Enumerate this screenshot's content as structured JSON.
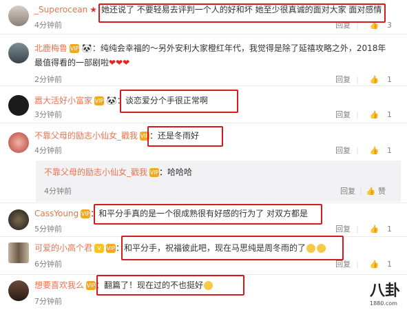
{
  "comments": [
    {
      "user": "_Superocean",
      "badge": "★",
      "text": "她还说了 不要轻易去评判一个人的好和坏 她至少很真诚的面对大家 面对感情",
      "time": "4分钟前",
      "reply": "回复",
      "likes": "3"
    },
    {
      "user": "北鹿梅鲁",
      "badge": "VIP",
      "text": "纯纯会幸福的～另外安利大家橙红年代，我觉得是除了延禧攻略之外，2018年最值得看的一部剧啦",
      "time": "2分钟前",
      "reply": "回复",
      "likes": "1"
    },
    {
      "user": "嚣大活好小富家",
      "badge": "VIP",
      "text": "谈恋爱分个手很正常啊",
      "time": "3分钟前",
      "reply": "回复",
      "likes": "1"
    },
    {
      "user": "不靠父母的励志小仙女_戳我",
      "badge": "VIP",
      "text": "还是冬雨好",
      "time": "4分钟前",
      "reply": "回复",
      "likes": "1"
    },
    {
      "user": "CassYoung",
      "badge": "VIP",
      "text": "和平分手真的是一个很成熟很有好感的行为了 对双方都是",
      "time": "5分钟前",
      "reply": "回复",
      "likes": "1"
    },
    {
      "user": "可爱的小高个君",
      "badge": "V",
      "text": "和平分手，祝福彼此吧，现在马思纯是周冬雨的了",
      "time": "6分钟前",
      "reply": "回复",
      "likes": "1"
    },
    {
      "user": "想要喜欢我么",
      "badge": "VIP",
      "text": "翻篇了！现在过的不也挺好",
      "time": "7分钟前",
      "reply": "回复",
      "likes": "1"
    }
  ],
  "sub_reply": {
    "user": "不靠父母的励志小仙女_戳我",
    "badge": "VIP",
    "text": "哈哈哈",
    "time": "4分钟前",
    "reply": "回复",
    "like_label": "赞"
  },
  "watermark": {
    "main": "八卦",
    "sub": "1880.com"
  },
  "colors": {
    "username": "#eb7350",
    "highlight": "#d61a1a"
  },
  "icons": {
    "like": "thumbs-up-icon",
    "separator": "|"
  }
}
